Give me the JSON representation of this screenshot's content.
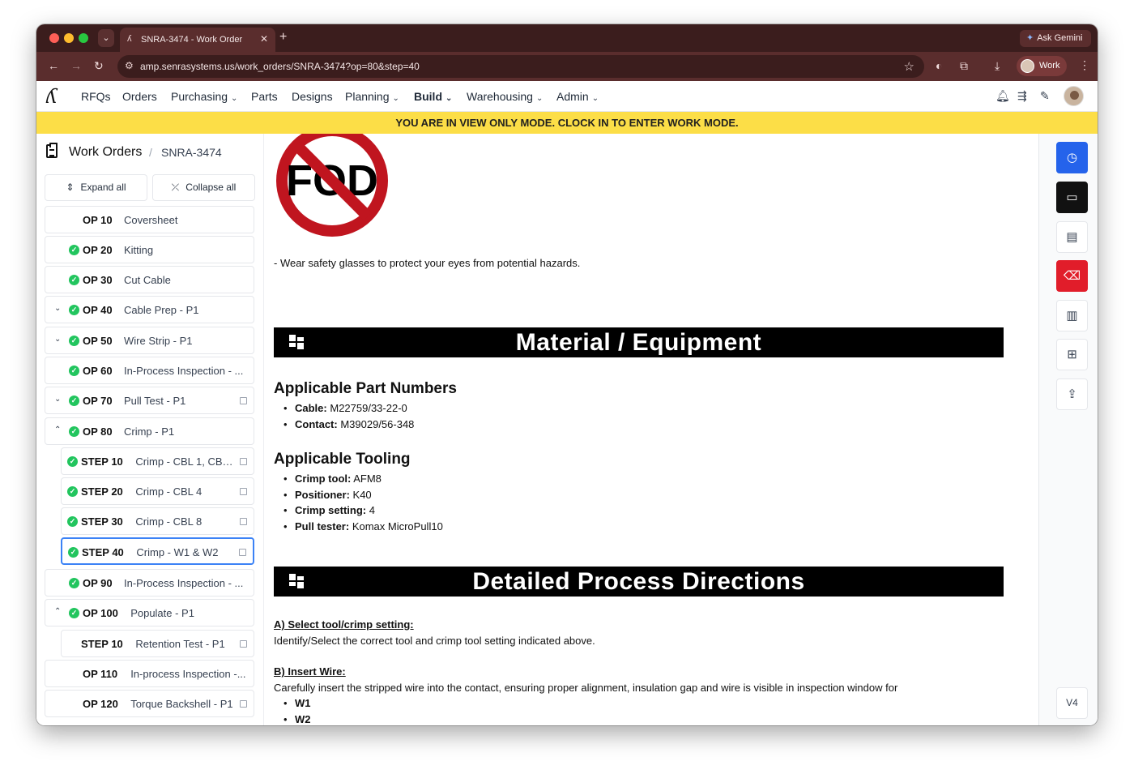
{
  "browser": {
    "tab_title": "SNRA-3474 - Work Order",
    "tab_close": "✕",
    "new_tab": "+",
    "tab_menu": "⌄",
    "gemini_label": "Ask Gemini",
    "url": "amp.senrasystems.us/work_orders/SNRA-3474?op=80&step=40",
    "profile_label": "Work"
  },
  "nav": {
    "items": [
      {
        "label": "RFQs",
        "chevron": false
      },
      {
        "label": "Orders",
        "chevron": false
      },
      {
        "label": "Purchasing",
        "chevron": true
      },
      {
        "label": "Parts",
        "chevron": false
      },
      {
        "label": "Designs",
        "chevron": false
      },
      {
        "label": "Planning",
        "chevron": true
      },
      {
        "label": "Build",
        "chevron": true,
        "active": true
      },
      {
        "label": "Warehousing",
        "chevron": true
      },
      {
        "label": "Admin",
        "chevron": true
      }
    ]
  },
  "banner": "YOU ARE IN VIEW ONLY MODE. CLOCK IN TO ENTER WORK MODE.",
  "sidebar": {
    "breadcrumb_root": "Work Orders",
    "breadcrumb_sep": "/",
    "breadcrumb_leaf": "SNRA-3474",
    "expand_all": "Expand all",
    "collapse_all": "Collapse all",
    "ops": [
      {
        "code": "OP 10",
        "name": "Coversheet",
        "check": false,
        "caret": "",
        "indent": false,
        "image": false,
        "selected": false
      },
      {
        "code": "OP 20",
        "name": "Kitting",
        "check": true,
        "caret": "",
        "indent": false,
        "image": false,
        "selected": false
      },
      {
        "code": "OP 30",
        "name": "Cut Cable",
        "check": true,
        "caret": "",
        "indent": false,
        "image": false,
        "selected": false
      },
      {
        "code": "OP 40",
        "name": "Cable Prep - P1",
        "check": true,
        "caret": "down",
        "indent": false,
        "image": false,
        "selected": false
      },
      {
        "code": "OP 50",
        "name": "Wire Strip - P1",
        "check": true,
        "caret": "down",
        "indent": false,
        "image": false,
        "selected": false
      },
      {
        "code": "OP 60",
        "name": "In-Process Inspection - ...",
        "check": true,
        "caret": "",
        "indent": false,
        "image": false,
        "selected": false
      },
      {
        "code": "OP 70",
        "name": "Pull Test - P1",
        "check": true,
        "caret": "down",
        "indent": false,
        "image": true,
        "selected": false
      },
      {
        "code": "OP 80",
        "name": "Crimp - P1",
        "check": true,
        "caret": "up",
        "indent": false,
        "image": false,
        "selected": false
      },
      {
        "code": "STEP 10",
        "name": "Crimp - CBL 1, CBL ...",
        "check": true,
        "caret": "",
        "indent": true,
        "image": true,
        "selected": false
      },
      {
        "code": "STEP 20",
        "name": "Crimp - CBL 4",
        "check": true,
        "caret": "",
        "indent": true,
        "image": true,
        "selected": false
      },
      {
        "code": "STEP 30",
        "name": "Crimp - CBL 8",
        "check": true,
        "caret": "",
        "indent": true,
        "image": true,
        "selected": false
      },
      {
        "code": "STEP 40",
        "name": "Crimp - W1 & W2",
        "check": true,
        "caret": "",
        "indent": true,
        "image": true,
        "selected": true
      },
      {
        "code": "OP 90",
        "name": "In-Process Inspection - ...",
        "check": true,
        "caret": "",
        "indent": false,
        "image": false,
        "selected": false
      },
      {
        "code": "OP 100",
        "name": "Populate - P1",
        "check": true,
        "caret": "up",
        "indent": false,
        "image": false,
        "selected": false
      },
      {
        "code": "STEP 10",
        "name": "Retention Test - P1",
        "check": false,
        "caret": "",
        "indent": true,
        "image": true,
        "selected": false
      },
      {
        "code": "OP 110",
        "name": "In-process Inspection -...",
        "check": false,
        "caret": "",
        "indent": false,
        "image": false,
        "selected": false
      },
      {
        "code": "OP 120",
        "name": "Torque Backshell - P1",
        "check": false,
        "caret": "",
        "indent": false,
        "image": true,
        "selected": false
      }
    ]
  },
  "content": {
    "fod_logo_text": "FOD",
    "safety_note": "- Wear safety glasses to protect your eyes from potential hazards.",
    "section_material": "Material / Equipment",
    "part_numbers_heading": "Applicable Part Numbers",
    "part_numbers": [
      {
        "label": "Cable:",
        "value": "M22759/33-22-0"
      },
      {
        "label": "Contact:",
        "value": "M39029/56-348"
      }
    ],
    "tooling_heading": "Applicable Tooling",
    "tooling": [
      {
        "label": "Crimp tool:",
        "value": "AFM8"
      },
      {
        "label": "Positioner:",
        "value": "K40"
      },
      {
        "label": "Crimp setting:",
        "value": "4"
      },
      {
        "label": "Pull tester:",
        "value": "Komax MicroPull10"
      }
    ],
    "section_process": "Detailed Process Directions",
    "step_a_heading": "A) Select tool/crimp setting:",
    "step_a_text": "Identify/Select the correct tool and crimp tool setting indicated above.",
    "step_b_heading": "B) Insert Wire:",
    "step_b_text": "Carefully insert the stripped wire into the contact, ensuring proper alignment, insulation gap and wire is visible in inspection window for",
    "step_b_items": [
      "W1",
      "W2"
    ]
  },
  "rail": {
    "version": "V4",
    "buttons": [
      "clock-icon",
      "comment-icon",
      "clipboard-check-icon",
      "eraser-icon",
      "chart-icon",
      "document-plus-icon",
      "share-icon"
    ]
  },
  "colors": {
    "chrome": "#3b1d1d",
    "banner": "#fcde47",
    "success": "#22c55e",
    "selected_border": "#3b82f6",
    "rail_blue": "#2563eb",
    "rail_red": "#e11d2a"
  }
}
